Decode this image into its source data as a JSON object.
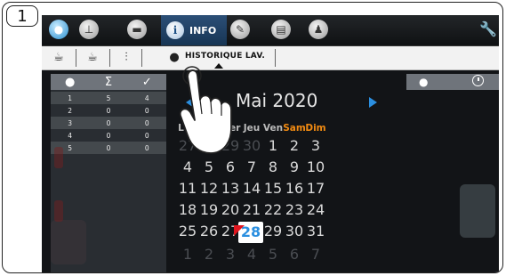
{
  "step": {
    "number": "1"
  },
  "topbar": {
    "tabs": [
      {
        "name": "drop",
        "icon": "water-drop-icon"
      },
      {
        "name": "clock-dispense",
        "icon": "dispense-icon"
      },
      {
        "name": "machine",
        "icon": "machine-icon"
      },
      {
        "name": "info",
        "icon": "info-icon",
        "label": "INFO",
        "active": true
      },
      {
        "name": "edit",
        "icon": "pencil-icon"
      },
      {
        "name": "display",
        "icon": "screen-icon"
      },
      {
        "name": "user",
        "icon": "user-icon"
      }
    ],
    "settings_icon": "wrench-icon"
  },
  "subbar": {
    "items": [
      "cup-icon",
      "cup-drip-icon",
      "sliders-icon"
    ],
    "active_label": "HISTORIQUE LAV.",
    "active_icon": "drop-list-icon"
  },
  "sidebar": {
    "headers": [
      "●",
      "Σ",
      "✓"
    ],
    "rows": [
      [
        "1",
        "5",
        "4"
      ],
      [
        "2",
        "0",
        "0"
      ],
      [
        "3",
        "0",
        "0"
      ],
      [
        "4",
        "0",
        "0"
      ],
      [
        "5",
        "0",
        "0"
      ]
    ]
  },
  "calendar": {
    "title": "Mai 2020",
    "weekdays": [
      "Lun",
      "Mar",
      "Mer",
      "Jeu",
      "Ven",
      "Sam",
      "Dim"
    ],
    "weeks": [
      [
        "27",
        "28",
        "29",
        "30",
        "1",
        "2",
        "3"
      ],
      [
        "4",
        "5",
        "6",
        "7",
        "8",
        "9",
        "10"
      ],
      [
        "11",
        "12",
        "13",
        "14",
        "15",
        "16",
        "17"
      ],
      [
        "18",
        "19",
        "20",
        "21",
        "22",
        "23",
        "24"
      ],
      [
        "25",
        "26",
        "27",
        "28",
        "29",
        "30",
        "31"
      ],
      [
        "1",
        "2",
        "3",
        "4",
        "5",
        "6",
        "7"
      ]
    ],
    "selected_day": "28",
    "accent_color": "#2b8fe0",
    "weekend_color": "#f08a12"
  }
}
